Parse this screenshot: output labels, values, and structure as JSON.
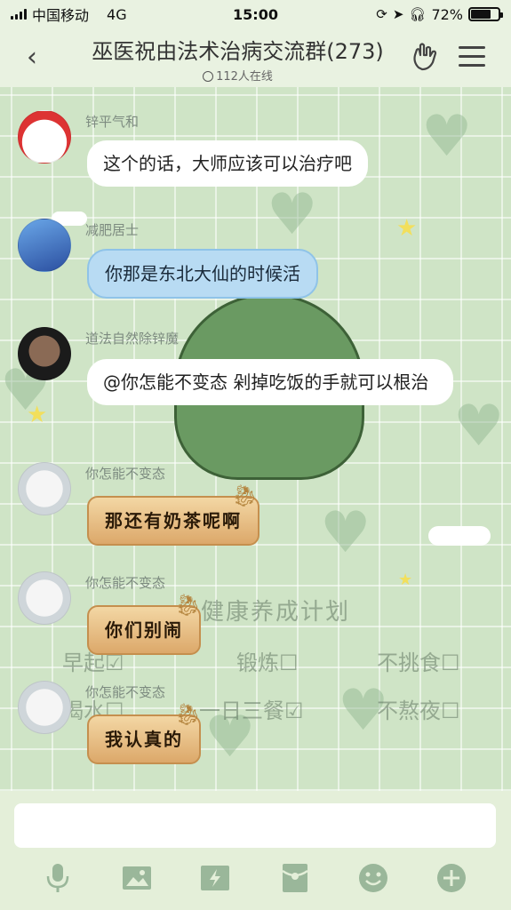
{
  "status": {
    "carrier": "中国移动",
    "network": "4G",
    "time": "15:00",
    "battery_text": "72%",
    "battery_level": 0.72
  },
  "header": {
    "back_icon": "‹",
    "title": "巫医祝由法术治病交流群(273)",
    "online": "112人在线"
  },
  "messages": [
    {
      "sender": "锌平气和",
      "text": "这个的话，大师应该可以治疗吧",
      "style": "white"
    },
    {
      "sender": "减肥居士",
      "text": "你那是东北大仙的时候活",
      "style": "blue"
    },
    {
      "sender": "道法自然除锌魔",
      "text": "@你怎能不变态 剁掉吃饭的手就可以根治",
      "style": "white"
    },
    {
      "sender": "你怎能不变态",
      "text": "那还有奶茶呢啊",
      "style": "gold"
    },
    {
      "sender": "你怎能不变态",
      "text": "你们别闹",
      "style": "gold"
    },
    {
      "sender": "你怎能不变态",
      "text": "我认真的",
      "style": "gold"
    }
  ],
  "background_plan": {
    "title": "健康养成计划",
    "items": [
      "早起☑",
      "锻炼☐",
      "不挑食☐",
      "喝水☐",
      "一日三餐☑",
      "不熬夜☐"
    ]
  },
  "colors": {
    "accent": "#cfe4c6",
    "bubble_blue": "#b8dbf3",
    "bubble_gold": "#dca86a"
  },
  "icons": [
    "back-icon",
    "hand-icon",
    "menu-icon",
    "mic-icon",
    "image-icon",
    "flash-icon",
    "redpacket-icon",
    "emoji-icon",
    "plus-icon"
  ]
}
